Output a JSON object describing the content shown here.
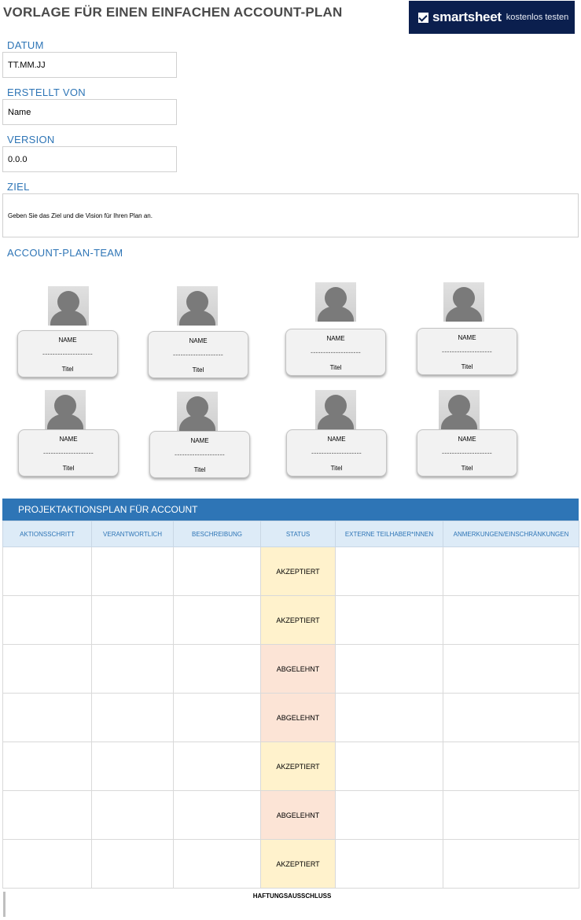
{
  "title": "VORLAGE FÜR EINEN EINFACHEN ACCOUNT-PLAN",
  "brand": {
    "name": "smartsheet",
    "cta": "kostenlos testen",
    "background": "#0b1f4e"
  },
  "fields": {
    "datum_label": "DATUM",
    "datum_value": "TT.MM.JJ",
    "erstellt_label": "ERSTELLT VON",
    "erstellt_value": "Name",
    "version_label": "VERSION",
    "version_value": "0.0.0",
    "ziel_label": "ZIEL",
    "ziel_value": "Geben Sie das Ziel und die Vision für Ihren Plan an."
  },
  "team": {
    "label": "ACCOUNT-PLAN-TEAM",
    "members": [
      {
        "name": "NAME",
        "dash": "--------------------",
        "title": "Titel"
      },
      {
        "name": "NAME",
        "dash": "--------------------",
        "title": "Titel"
      },
      {
        "name": "NAME",
        "dash": "--------------------",
        "title": "Titel"
      },
      {
        "name": "NAME",
        "dash": "--------------------",
        "title": "Titel"
      },
      {
        "name": "NAME",
        "dash": "--------------------",
        "title": "Titel"
      },
      {
        "name": "NAME",
        "dash": "--------------------",
        "title": "Titel"
      },
      {
        "name": "NAME",
        "dash": "--------------------",
        "title": "Titel"
      },
      {
        "name": "NAME",
        "dash": "--------------------",
        "title": "Titel"
      }
    ]
  },
  "plan": {
    "header": "PROJEKTAKTIONSPLAN FÜR ACCOUNT",
    "columns": [
      "AKTIONSSCHRITT",
      "VERANTWORTLICH",
      "BESCHREIBUNG",
      "STATUS",
      "EXTERNE TEILHABER*INNEN",
      "ANMERKUNGEN/EINSCHRÄNKUNGEN"
    ],
    "rows": [
      {
        "status": "AKZEPTIERT"
      },
      {
        "status": "AKZEPTIERT"
      },
      {
        "status": "ABGELEHNT"
      },
      {
        "status": "ABGELEHNT"
      },
      {
        "status": "AKZEPTIERT"
      },
      {
        "status": "ABGELEHNT"
      },
      {
        "status": "AKZEPTIERT"
      }
    ],
    "status_colors": {
      "AKZEPTIERT": "#fff2cc",
      "ABGELEHNT": "#fce4d6"
    }
  },
  "disclaimer": "HAFTUNGSAUSSCHLUSS"
}
